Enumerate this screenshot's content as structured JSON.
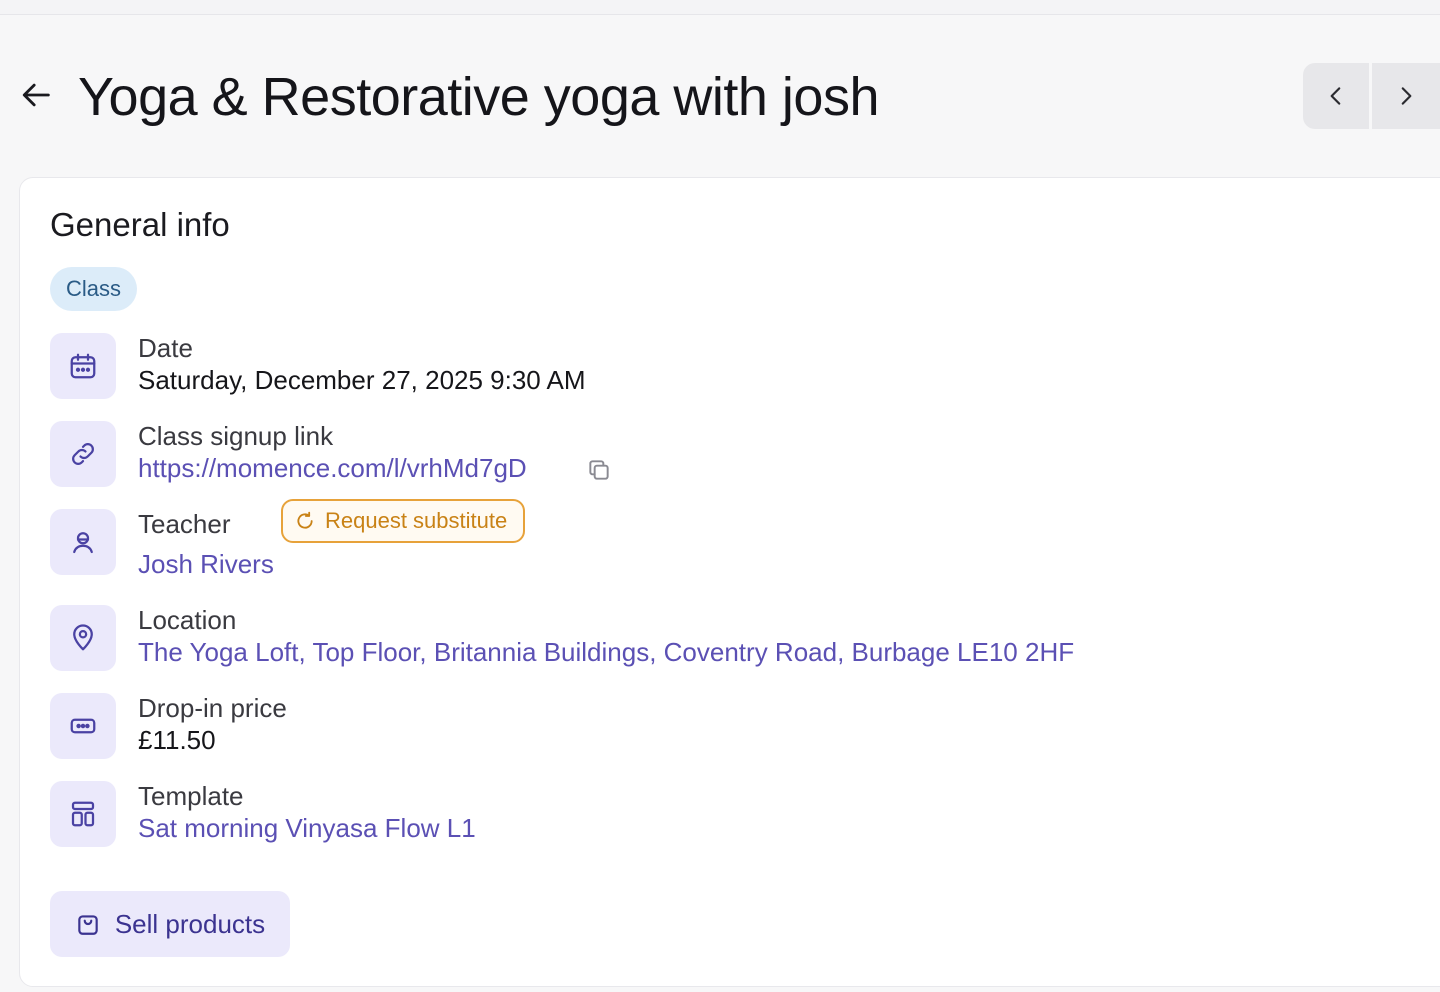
{
  "page": {
    "title": "Yoga & Restorative yoga with josh"
  },
  "general": {
    "section_title": "General info",
    "badge": "Class",
    "date": {
      "label": "Date",
      "value": "Saturday, December 27, 2025 9:30 AM"
    },
    "signup": {
      "label": "Class signup link",
      "value": "https://momence.com/l/vrhMd7gD"
    },
    "teacher": {
      "label": "Teacher",
      "value": "Josh Rivers",
      "request_label": "Request substitute"
    },
    "location": {
      "label": "Location",
      "value": "The Yoga Loft, Top Floor, Britannia Buildings, Coventry Road, Burbage LE10 2HF"
    },
    "price": {
      "label": "Drop-in price",
      "value": "£11.50"
    },
    "template": {
      "label": "Template",
      "value": "Sat morning Vinyasa Flow L1"
    },
    "sell_button": "Sell products"
  },
  "icons": {
    "back": "arrow-left-icon",
    "prev": "chevron-left-icon",
    "next": "chevron-right-icon",
    "date": "calendar-icon",
    "signup": "link-icon",
    "copy": "copy-icon",
    "teacher": "user-icon",
    "refresh": "refresh-icon",
    "location": "map-pin-icon",
    "price": "ticket-icon",
    "template": "template-icon",
    "sell": "shopping-bag-icon"
  },
  "colors": {
    "accent": "#5b50b4",
    "icon_bg": "#ebe9fb",
    "warning": "#e7a23a",
    "badge_bg": "#dcecf9"
  }
}
